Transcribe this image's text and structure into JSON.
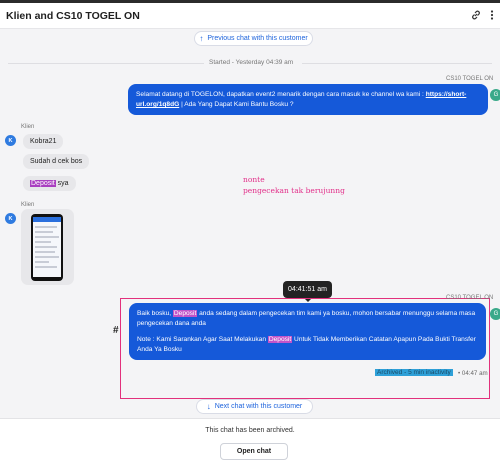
{
  "header": {
    "title": "Klien and CS10 TOGEL ON",
    "icons": [
      "link-icon",
      "more-vertical-icon"
    ]
  },
  "nav": {
    "previous_chat": "Previous chat with this customer",
    "next_chat": "Next chat with this customer"
  },
  "started_label": "Started - Yesterday 04:39 am",
  "agent": {
    "name": "CS10 TOGEL ON",
    "avatar_letter": "G"
  },
  "messages": {
    "welcome": {
      "prefix": "Selamat datang di TOGELON, dapatkan event2 menarik dengan cara masuk ke channel wa kami : ",
      "link": "https://short-url.org/1q8dG",
      "suffix": " | Ada Yang Dapat Kami Bantu Bosku ?"
    },
    "client_name": "Klien",
    "client_avatar_letter": "K",
    "client_msgs": [
      "Kobra21",
      "Sudah d cek bos"
    ],
    "client_deposit": {
      "word": "Deposit",
      "rest": " sya"
    },
    "agent_reply": {
      "p1_a": "Baik bosku, ",
      "p1_word": "Deposit",
      "p1_b": " anda sedang dalam pengecekan tim kami ya bosku, mohon bersabar menunggu selama masa pengecekan dana anda",
      "p2_a": "Note : Kami Sarankan Agar Saat Melakukan ",
      "p2_word": "Deposit",
      "p2_b": " Untuk Tidak Memberikan Catatan Apapun Pada Bukti Transfer Anda Ya Bosku"
    }
  },
  "annotation": {
    "line1": "nonte",
    "line2": "pengecekan tak berujunng",
    "hash": "#"
  },
  "tooltip_time": "04:41:51 am",
  "archived_label": "Archived - 5 min inactivity",
  "archived_time": "• 04:47 am",
  "footer": {
    "text": "This chat has been archived.",
    "button": "Open chat"
  },
  "colors": {
    "accent": "#1559d9",
    "highlight": "#a93fc0",
    "annotation": "#e2308a"
  }
}
